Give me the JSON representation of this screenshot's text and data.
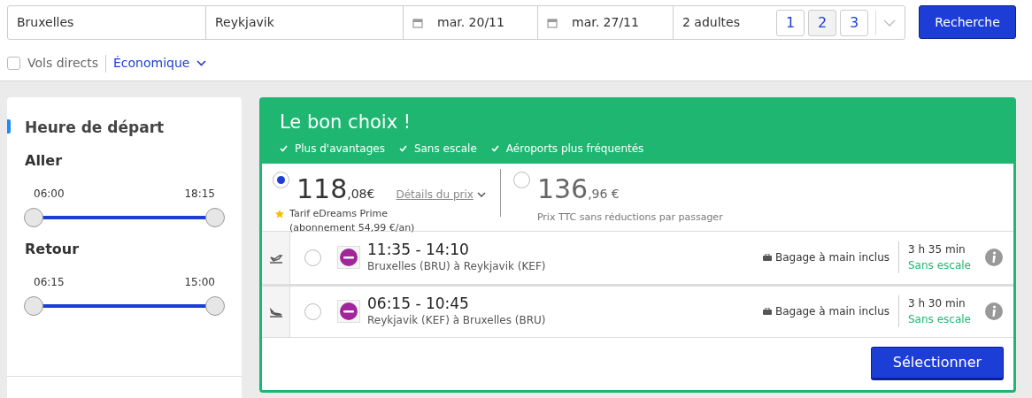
{
  "search": {
    "origin": "Bruxelles",
    "destination": "Reykjavik",
    "depart_date": "mar. 20/11",
    "return_date": "mar. 27/11",
    "passengers": "2 adultes",
    "passenger_counts": [
      {
        "label": "1",
        "selected": false
      },
      {
        "label": "2",
        "selected": true
      },
      {
        "label": "3",
        "selected": false
      }
    ],
    "search_button": "Recherche"
  },
  "options": {
    "direct_only": {
      "label": "Vols directs",
      "checked": false
    },
    "cabin": "Économique"
  },
  "filters": {
    "title": "Heure de départ",
    "sliders": [
      {
        "label": "Aller",
        "from": "06:00",
        "to": "18:15",
        "level": 1
      },
      {
        "label": "Retour",
        "from": "06:15",
        "to": "15:00",
        "level": 1
      }
    ]
  },
  "offer": {
    "title": "Le bon choix !",
    "features": [
      "Plus d'avantages",
      "Sans escale",
      "Aéroports plus fréquentés"
    ],
    "prices": [
      {
        "kind": "prime",
        "whole": "118",
        "cents": ",08€",
        "details_link": "Détails du prix",
        "note_line1": "Tarif eDreams Prime",
        "note_line2": "(abonnement 54,99 €/an)",
        "selected": true
      },
      {
        "kind": "standard",
        "whole": "136",
        "cents": ",96 €",
        "note_line1": "Prix TTC sans réductions par passager",
        "selected": false
      }
    ],
    "legs": [
      {
        "kind": "outbound",
        "times": "11:35 - 14:10",
        "route": "Bruxelles (BRU) à Reykjavik (KEF)",
        "baggage": "Bagage à main inclus",
        "duration": "3 h 35 min",
        "stops": "Sans escale",
        "selected": false
      },
      {
        "kind": "return",
        "times": "06:15 - 10:45",
        "route": "Reykjavik (KEF) à Bruxelles (BRU)",
        "baggage": "Bagage à main inclus",
        "duration": "3 h 30 min",
        "stops": "Sans escale",
        "selected": false
      }
    ],
    "select_button": "Sélectionner"
  }
}
